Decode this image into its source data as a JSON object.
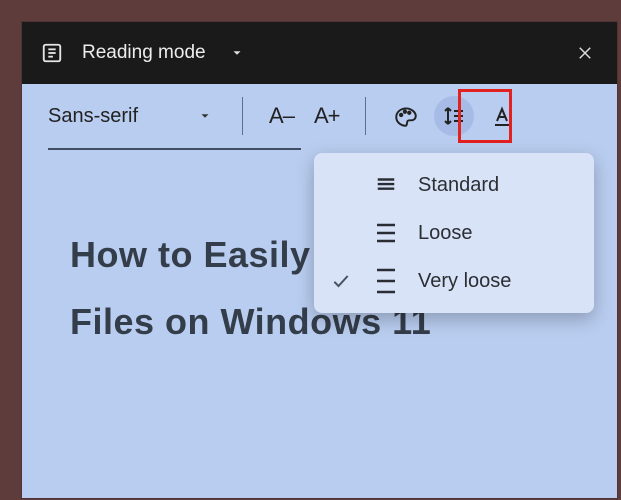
{
  "titlebar": {
    "mode_label": "Reading mode"
  },
  "toolbar": {
    "font_family": "Sans-serif",
    "decrease_label": "A–",
    "increase_label": "A+"
  },
  "content": {
    "heading": "How to Easily Compress Files on Windows 11"
  },
  "menu": {
    "items": [
      {
        "label": "Standard",
        "checked": false,
        "density": "tight"
      },
      {
        "label": "Loose",
        "checked": false,
        "density": "medium"
      },
      {
        "label": "Very loose",
        "checked": true,
        "density": "loose"
      }
    ]
  },
  "colors": {
    "page_bg": "#b9cdf0",
    "menu_bg": "#d9e3f7",
    "highlight": "#e22121",
    "titlebar_bg": "#1a1a1a"
  }
}
